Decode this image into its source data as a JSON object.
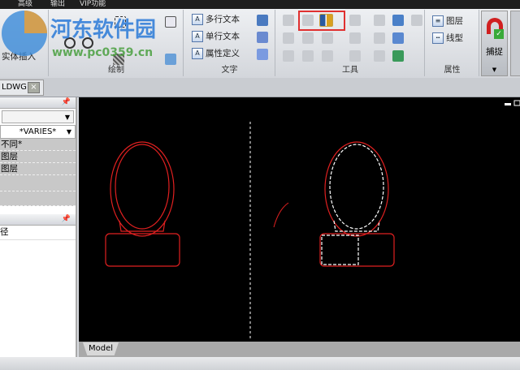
{
  "menu": {
    "items": [
      "高级",
      "输出",
      "VIP功能"
    ]
  },
  "ribbon": {
    "left_group": {
      "items": [
        "实体插入"
      ]
    },
    "draw_group": {
      "label": "绘制"
    },
    "text_group": {
      "label": "文字",
      "items": [
        "多行文本",
        "单行文本",
        "属性定义"
      ]
    },
    "tools_group": {
      "label": "工具"
    },
    "props_group": {
      "label": "属性",
      "items": [
        "图层",
        "线型"
      ]
    },
    "snap": {
      "label": "捕捉"
    }
  },
  "watermark": {
    "title": "河东软件园",
    "url": "www.pc0359.cn"
  },
  "doc_tab": {
    "label": "LDWG",
    "close": "×"
  },
  "panel": {
    "selector_value": "*VARIES*",
    "rows": [
      "不同*",
      "图层",
      "图层"
    ],
    "section2_row": "径"
  },
  "canvas": {
    "model_tab": "Model"
  },
  "colors": {
    "accent_red": "#e02020",
    "highlight_box": "#e03030"
  }
}
